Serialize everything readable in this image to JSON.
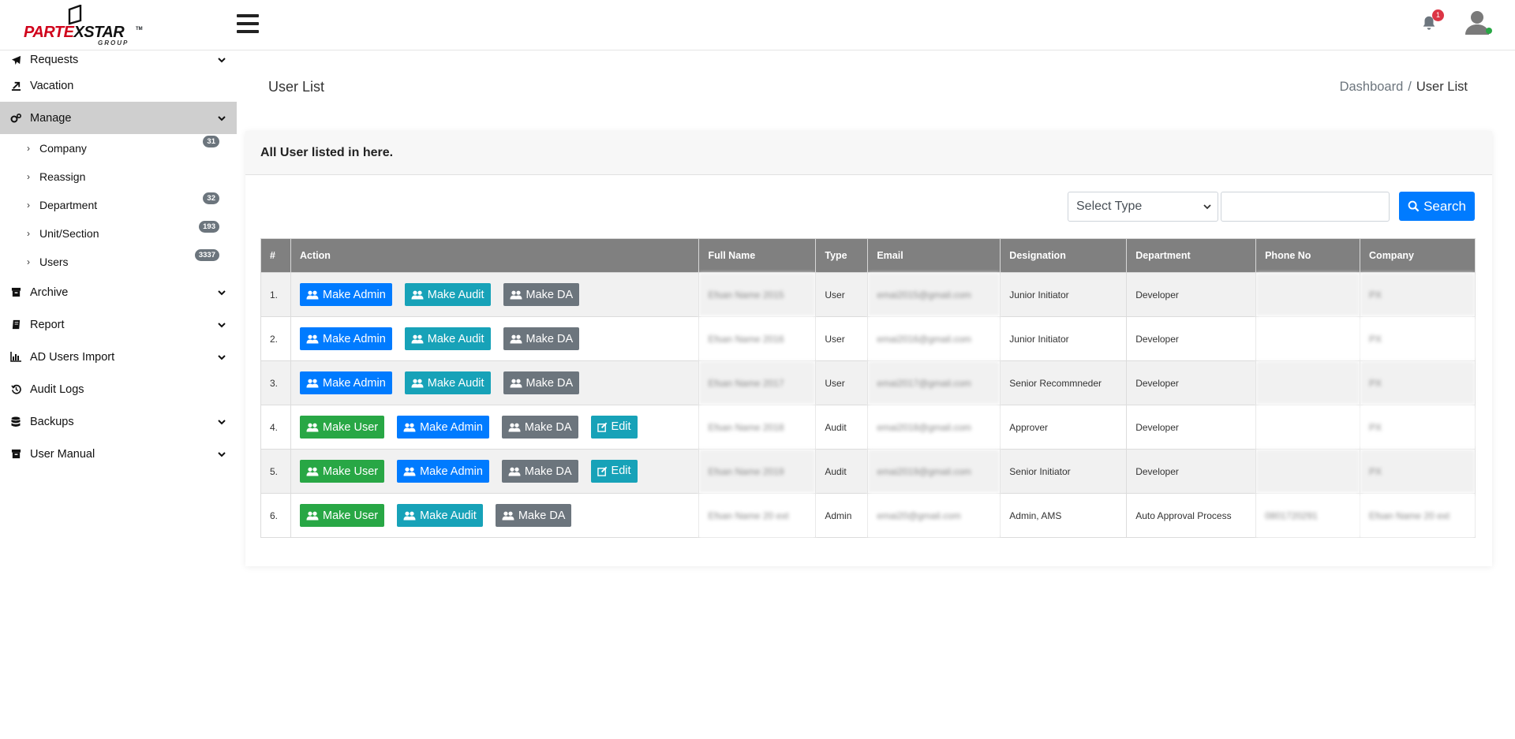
{
  "header": {
    "logo_text_a": "PARTE",
    "logo_text_b": "XSTAR",
    "logo_group": "GROUP",
    "notification_count": "1"
  },
  "sidebar": {
    "items": [
      {
        "label": "Requests",
        "icon": "paper-plane-icon",
        "chevron": true
      },
      {
        "label": "Vacation",
        "icon": "plane-icon",
        "chevron": false
      },
      {
        "label": "Manage",
        "icon": "cogs-icon",
        "chevron": true,
        "active": true
      },
      {
        "label": "Archive",
        "icon": "archive-icon",
        "chevron": true
      },
      {
        "label": "Report",
        "icon": "book-icon",
        "chevron": true
      },
      {
        "label": "AD Users Import",
        "icon": "bar-chart-icon",
        "chevron": true
      },
      {
        "label": "Audit Logs",
        "icon": "history-icon",
        "chevron": false
      },
      {
        "label": "Backups",
        "icon": "database-icon",
        "chevron": true
      },
      {
        "label": "User Manual",
        "icon": "archive-icon",
        "chevron": true
      }
    ],
    "manage_sub": [
      {
        "label": "Company",
        "count": "31"
      },
      {
        "label": "Reassign",
        "count": ""
      },
      {
        "label": "Department",
        "count": "32"
      },
      {
        "label": "Unit/Section",
        "count": "193"
      },
      {
        "label": "Users",
        "count": "3337"
      }
    ]
  },
  "page": {
    "title": "User List",
    "breadcrumb_home": "Dashboard",
    "breadcrumb_sep": "/",
    "breadcrumb_current": "User List"
  },
  "card": {
    "header": "All User listed in here.",
    "select_placeholder": "Select Type",
    "search_label": "Search"
  },
  "table": {
    "columns": [
      "#",
      "Action",
      "Full Name",
      "Type",
      "Email",
      "Designation",
      "Department",
      "Phone No",
      "Company"
    ],
    "rows": [
      {
        "num": "1.",
        "actions": [
          "Make Admin",
          "Make Audit",
          "Make DA"
        ],
        "full_name": "Efsan Name 2015",
        "type": "User",
        "email": "emai2015@gmail.com",
        "designation": "Junior Initiator",
        "department": "Developer",
        "phone": "",
        "company": "PX"
      },
      {
        "num": "2.",
        "actions": [
          "Make Admin",
          "Make Audit",
          "Make DA"
        ],
        "full_name": "Efsan Name 2016",
        "type": "User",
        "email": "emai2016@gmail.com",
        "designation": "Junior Initiator",
        "department": "Developer",
        "phone": "",
        "company": "PX"
      },
      {
        "num": "3.",
        "actions": [
          "Make Admin",
          "Make Audit",
          "Make DA"
        ],
        "full_name": "Efsan Name 2017",
        "type": "User",
        "email": "emai2017@gmail.com",
        "designation": "Senior Recommneder",
        "department": "Developer",
        "phone": "",
        "company": "PX"
      },
      {
        "num": "4.",
        "actions": [
          "Make User",
          "Make Admin",
          "Make DA",
          "Edit"
        ],
        "full_name": "Efsan Name 2018",
        "type": "Audit",
        "email": "emai2018@gmail.com",
        "designation": "Approver",
        "department": "Developer",
        "phone": "",
        "company": "PX"
      },
      {
        "num": "5.",
        "actions": [
          "Make User",
          "Make Admin",
          "Make DA",
          "Edit"
        ],
        "full_name": "Efsan Name 2019",
        "type": "Audit",
        "email": "emai2019@gmail.com",
        "designation": "Senior Initiator",
        "department": "Developer",
        "phone": "",
        "company": "PX"
      },
      {
        "num": "6.",
        "actions": [
          "Make User",
          "Make Audit",
          "Make DA"
        ],
        "full_name": "Efsan Name 20 ext",
        "type": "Admin",
        "email": "emai20@gmail.com",
        "designation": "Admin, AMS",
        "department": "Auto Approval Process",
        "phone": "0801720291",
        "company": "Efsan Name 20 ext"
      }
    ]
  },
  "colors": {
    "make_admin": "#007bff",
    "make_audit": "#17a2b8",
    "make_da": "#6c757d",
    "make_user": "#28a745",
    "edit": "#17a2b8",
    "table_header": "#808080",
    "sidebar_active": "#cfcfcf"
  }
}
